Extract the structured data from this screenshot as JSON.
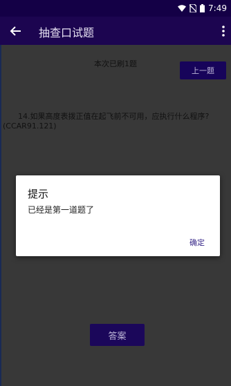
{
  "status": {
    "time": "7:49"
  },
  "app_bar": {
    "title": "抽查口试题"
  },
  "content": {
    "progress_text": "本次已刷1题",
    "prev_button": "上一题",
    "question_text": "14.如果高度表拨正值在起飞前不可用，应执行什么程序?(CCAR91.121)",
    "answer_button": "答案"
  },
  "dialog": {
    "title": "提示",
    "message": "已经是第一道题了",
    "ok_label": "确定"
  }
}
